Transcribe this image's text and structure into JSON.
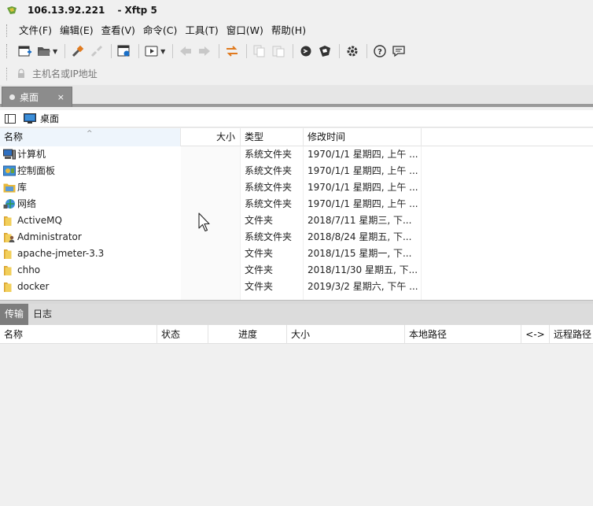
{
  "window": {
    "host": "106.13.92.221",
    "separator": "-",
    "app_name": "Xftp 5"
  },
  "menu": {
    "items": [
      "文件(F)",
      "编辑(E)",
      "查看(V)",
      "命令(C)",
      "工具(T)",
      "窗口(W)",
      "帮助(H)"
    ]
  },
  "toolbar": {
    "icons": [
      "new-session-icon",
      "open-folder-icon",
      "connect-icon",
      "disconnect-icon",
      "properties-icon",
      "run-icon",
      "back-icon",
      "forward-icon",
      "sync-icon",
      "copy-icon",
      "paste-icon",
      "xshell-icon",
      "xftp-icon",
      "settings-icon",
      "help-icon",
      "chat-icon"
    ]
  },
  "address": {
    "placeholder": "主机名或IP地址"
  },
  "tab": {
    "label": "桌面",
    "close": "×"
  },
  "path": {
    "label": "桌面"
  },
  "file_list": {
    "columns": {
      "name": "名称",
      "size": "大小",
      "type": "类型",
      "mtime": "修改时间"
    },
    "rows": [
      {
        "name": "计算机",
        "type": "系统文件夹",
        "mtime": "1970/1/1 星期四, 上午 ...",
        "icon": "computer-icon"
      },
      {
        "name": "控制面板",
        "type": "系统文件夹",
        "mtime": "1970/1/1 星期四, 上午 ...",
        "icon": "control-panel-icon"
      },
      {
        "name": "库",
        "type": "系统文件夹",
        "mtime": "1970/1/1 星期四, 上午 ...",
        "icon": "library-icon"
      },
      {
        "name": "网络",
        "type": "系统文件夹",
        "mtime": "1970/1/1 星期四, 上午 ...",
        "icon": "network-icon"
      },
      {
        "name": "ActiveMQ",
        "type": "文件夹",
        "mtime": "2018/7/11 星期三, 下...",
        "icon": "folder-icon"
      },
      {
        "name": "Administrator",
        "type": "系统文件夹",
        "mtime": "2018/8/24 星期五, 下...",
        "icon": "user-folder-icon"
      },
      {
        "name": "apache-jmeter-3.3",
        "type": "文件夹",
        "mtime": "2018/1/15 星期一, 下...",
        "icon": "folder-icon"
      },
      {
        "name": "chho",
        "type": "文件夹",
        "mtime": "2018/11/30 星期五, 下...",
        "icon": "folder-icon"
      },
      {
        "name": "docker",
        "type": "文件夹",
        "mtime": "2019/3/2 星期六, 下午 ...",
        "icon": "folder-icon"
      }
    ]
  },
  "transfer": {
    "tabs": [
      "传输",
      "日志"
    ],
    "columns": [
      "名称",
      "状态",
      "进度",
      "大小",
      "本地路径",
      "<->",
      "远程路径"
    ]
  },
  "colors": {
    "tab_bg": "#8c8c8c",
    "folder_yellow": "#e8b83a",
    "accent_orange": "#e07a1f"
  }
}
